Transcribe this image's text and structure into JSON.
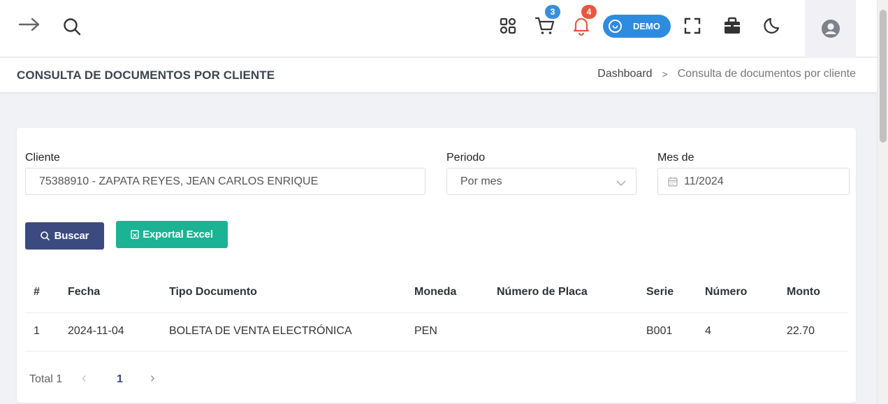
{
  "topbar": {
    "icons": [
      "arrow-right-icon",
      "search-icon",
      "apps-grid-icon",
      "cart-icon",
      "bell-icon",
      "fullscreen-icon",
      "briefcase-icon",
      "moon-icon",
      "user-icon"
    ],
    "cart_badge": "3",
    "notifications_badge": "4",
    "demo_label": "DEMO",
    "colors": {
      "cart_badge": "#3a8fd9",
      "notifications_badge": "#e9573f",
      "bell": "#e9573f",
      "demo": "#2f8bdf"
    }
  },
  "header": {
    "title": "CONSULTA DE DOCUMENTOS POR CLIENTE",
    "breadcrumb": {
      "home": "Dashboard",
      "separator": ">",
      "current": "Consulta de documentos por cliente"
    }
  },
  "filters": {
    "cliente": {
      "label": "Cliente",
      "value": "75388910 - ZAPATA REYES, JEAN CARLOS ENRIQUE"
    },
    "periodo": {
      "label": "Periodo",
      "value": "Por mes"
    },
    "mes": {
      "label": "Mes de",
      "value": "11/2024"
    }
  },
  "buttons": {
    "buscar": "Buscar",
    "exportar": "Exportal Excel",
    "colors": {
      "buscar": "#3b4a7f",
      "exportar": "#1bb394"
    }
  },
  "table": {
    "headers": [
      "#",
      "Fecha",
      "Tipo Documento",
      "Moneda",
      "Número de Placa",
      "Serie",
      "Número",
      "Monto"
    ],
    "rows": [
      [
        "1",
        "2024-11-04",
        "BOLETA DE VENTA ELECTRÓNICA",
        "PEN",
        "",
        "B001",
        "4",
        "22.70"
      ]
    ]
  },
  "pagination": {
    "total": "Total 1",
    "current_page": "1",
    "prev": "‹",
    "next": "›"
  }
}
